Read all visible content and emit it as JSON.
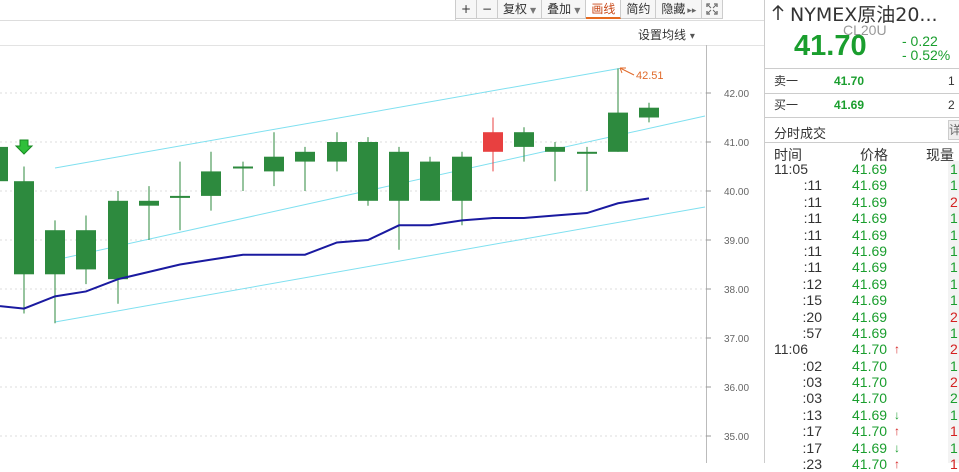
{
  "toolbar": {
    "zoom_in": "+",
    "zoom_out": "−",
    "adjust": "复权",
    "overlay": "叠加",
    "draw": "画线",
    "simple": "简约",
    "hide": "隐藏",
    "hide_arrows": "▸▸",
    "fullscreen_icon": "fullscreen-icon"
  },
  "ma_setting": {
    "label": "设置均线",
    "caret": "▾"
  },
  "chart": {
    "y_labels": [
      "42.00",
      "41.00",
      "40.00",
      "39.00",
      "38.00",
      "37.00",
      "36.00",
      "35.00"
    ],
    "max_annotation": "42.51",
    "colors": {
      "up": "#e84040",
      "down": "#2d8a3e",
      "ma": "#1a1aa0",
      "channel": "#7fe0f0",
      "annotation": "#e06a2a"
    }
  },
  "quote": {
    "symbol_name": "NYMEX原油20...",
    "symbol_code": "CL20U",
    "last_price": "41.70",
    "change_abs": "- 0.22",
    "change_pct": "- 0.52%",
    "back_icon": "up-arrow-icon"
  },
  "order_book": [
    {
      "label": "卖一",
      "price": "41.70",
      "vol": "1"
    },
    {
      "label": "买一",
      "price": "41.69",
      "vol": "2"
    }
  ],
  "ticks": {
    "title": "分时成交",
    "more": "详",
    "headers": {
      "time": "时间",
      "price": "价格",
      "vol": "现量"
    },
    "rows": [
      {
        "time": "11:05",
        "price": "41.69",
        "arrow": "",
        "vol": "1",
        "dir": "down"
      },
      {
        "time": ":11",
        "price": "41.69",
        "arrow": "",
        "vol": "1",
        "dir": "down"
      },
      {
        "time": ":11",
        "price": "41.69",
        "arrow": "",
        "vol": "2",
        "dir": "up"
      },
      {
        "time": ":11",
        "price": "41.69",
        "arrow": "",
        "vol": "1",
        "dir": "down"
      },
      {
        "time": ":11",
        "price": "41.69",
        "arrow": "",
        "vol": "1",
        "dir": "down"
      },
      {
        "time": ":11",
        "price": "41.69",
        "arrow": "",
        "vol": "1",
        "dir": "down"
      },
      {
        "time": ":11",
        "price": "41.69",
        "arrow": "",
        "vol": "1",
        "dir": "down"
      },
      {
        "time": ":12",
        "price": "41.69",
        "arrow": "",
        "vol": "1",
        "dir": "down"
      },
      {
        "time": ":15",
        "price": "41.69",
        "arrow": "",
        "vol": "1",
        "dir": "down"
      },
      {
        "time": ":20",
        "price": "41.69",
        "arrow": "",
        "vol": "2",
        "dir": "up"
      },
      {
        "time": ":57",
        "price": "41.69",
        "arrow": "",
        "vol": "1",
        "dir": "down"
      },
      {
        "time": "11:06",
        "price": "41.70",
        "arrow": "↑",
        "vol": "2",
        "dir": "up"
      },
      {
        "time": ":02",
        "price": "41.70",
        "arrow": "",
        "vol": "1",
        "dir": "down"
      },
      {
        "time": ":03",
        "price": "41.70",
        "arrow": "",
        "vol": "2",
        "dir": "up"
      },
      {
        "time": ":03",
        "price": "41.70",
        "arrow": "",
        "vol": "2",
        "dir": "down"
      },
      {
        "time": ":13",
        "price": "41.69",
        "arrow": "↓",
        "vol": "1",
        "dir": "down"
      },
      {
        "time": ":17",
        "price": "41.70",
        "arrow": "↑",
        "vol": "1",
        "dir": "up"
      },
      {
        "time": ":17",
        "price": "41.69",
        "arrow": "↓",
        "vol": "1",
        "dir": "down"
      },
      {
        "time": ":23",
        "price": "41.70",
        "arrow": "↑",
        "vol": "1",
        "dir": "up"
      }
    ]
  }
}
